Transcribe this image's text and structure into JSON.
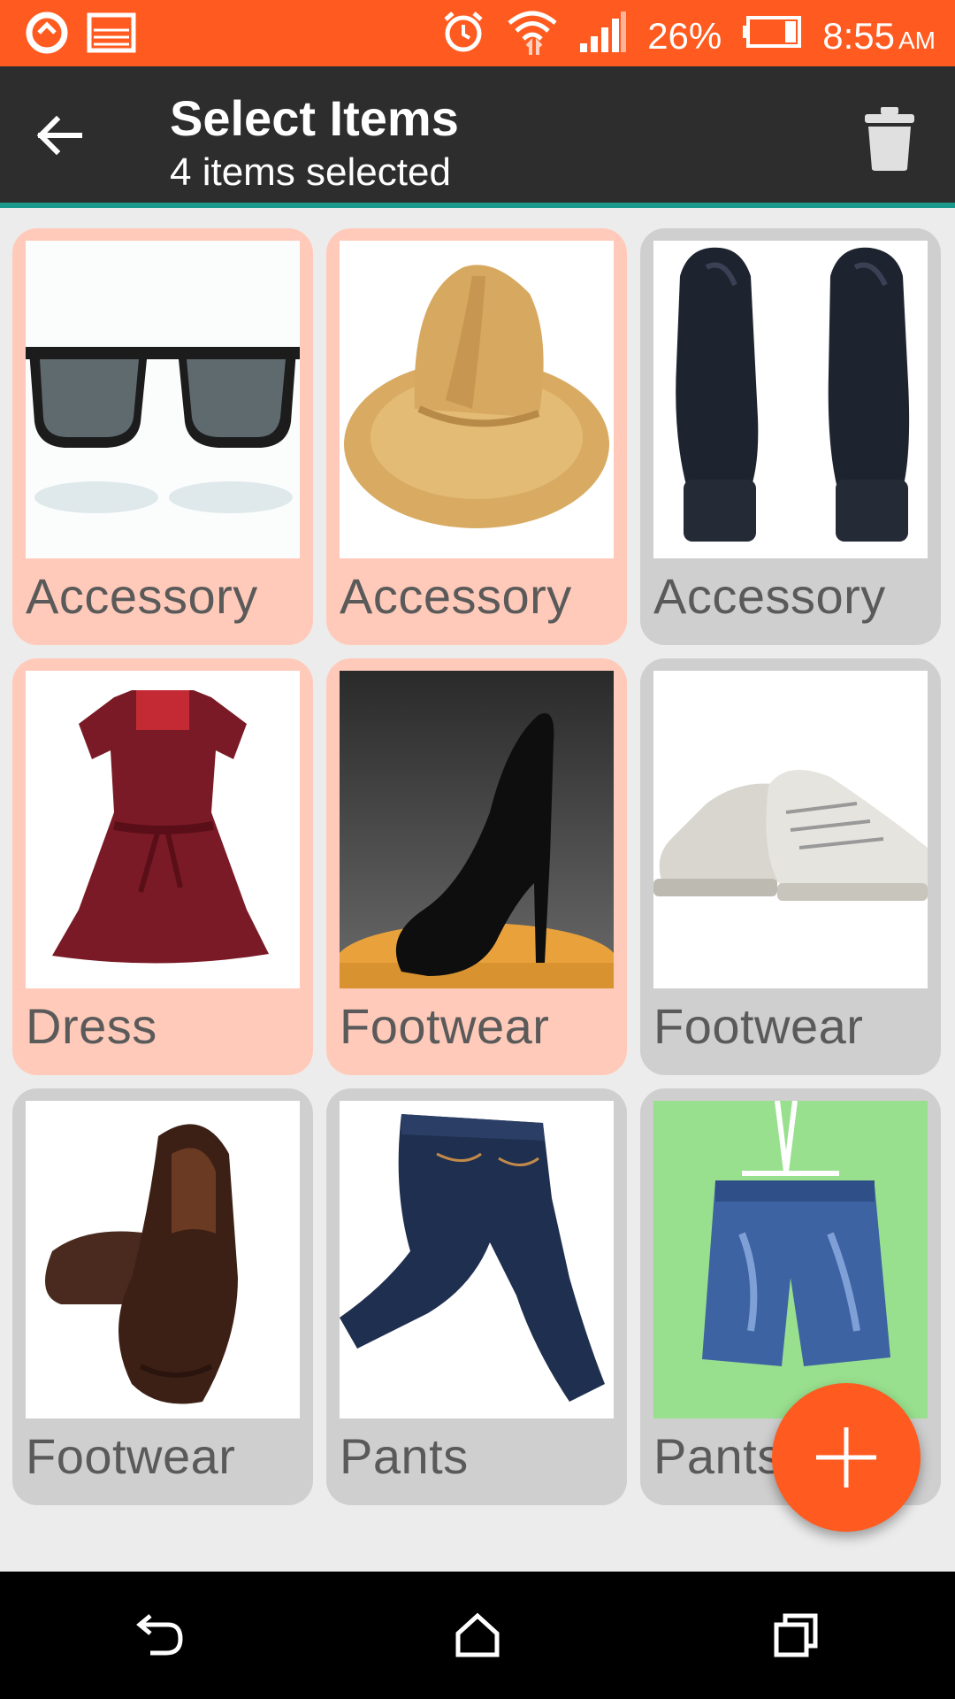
{
  "status_bar": {
    "battery": "26%",
    "time": "8:55",
    "ampm": "AM",
    "icons": [
      "sync-icon",
      "image-icon",
      "alarm-icon",
      "wifi-icon",
      "signal-icon",
      "battery-icon"
    ]
  },
  "app_bar": {
    "title": "Select Items",
    "subtitle": "4 items selected",
    "back_icon": "arrow-back-icon",
    "delete_icon": "trash-icon"
  },
  "items": [
    {
      "label": "Accessory",
      "selected": true,
      "image": "sunglasses"
    },
    {
      "label": "Accessory",
      "selected": true,
      "image": "straw-hat"
    },
    {
      "label": "Accessory",
      "selected": false,
      "image": "black-mittens"
    },
    {
      "label": "Dress",
      "selected": true,
      "image": "red-dress"
    },
    {
      "label": "Footwear",
      "selected": true,
      "image": "black-high-heel"
    },
    {
      "label": "Footwear",
      "selected": false,
      "image": "white-sneakers"
    },
    {
      "label": "Footwear",
      "selected": false,
      "image": "brown-loafers"
    },
    {
      "label": "Pants",
      "selected": false,
      "image": "blue-jeans"
    },
    {
      "label": "Pants",
      "selected": false,
      "image": "denim-shorts"
    }
  ],
  "fab": {
    "icon": "plus-icon"
  },
  "nav_bar": {
    "icons": [
      "back-nav-icon",
      "home-nav-icon",
      "recents-nav-icon"
    ]
  },
  "colors": {
    "accent": "#ff5a1f",
    "app_bar": "#2d2d2d",
    "divider": "#1a9a8c",
    "selected_card": "#ffcab9",
    "unselected_card": "#cfcfcf"
  }
}
